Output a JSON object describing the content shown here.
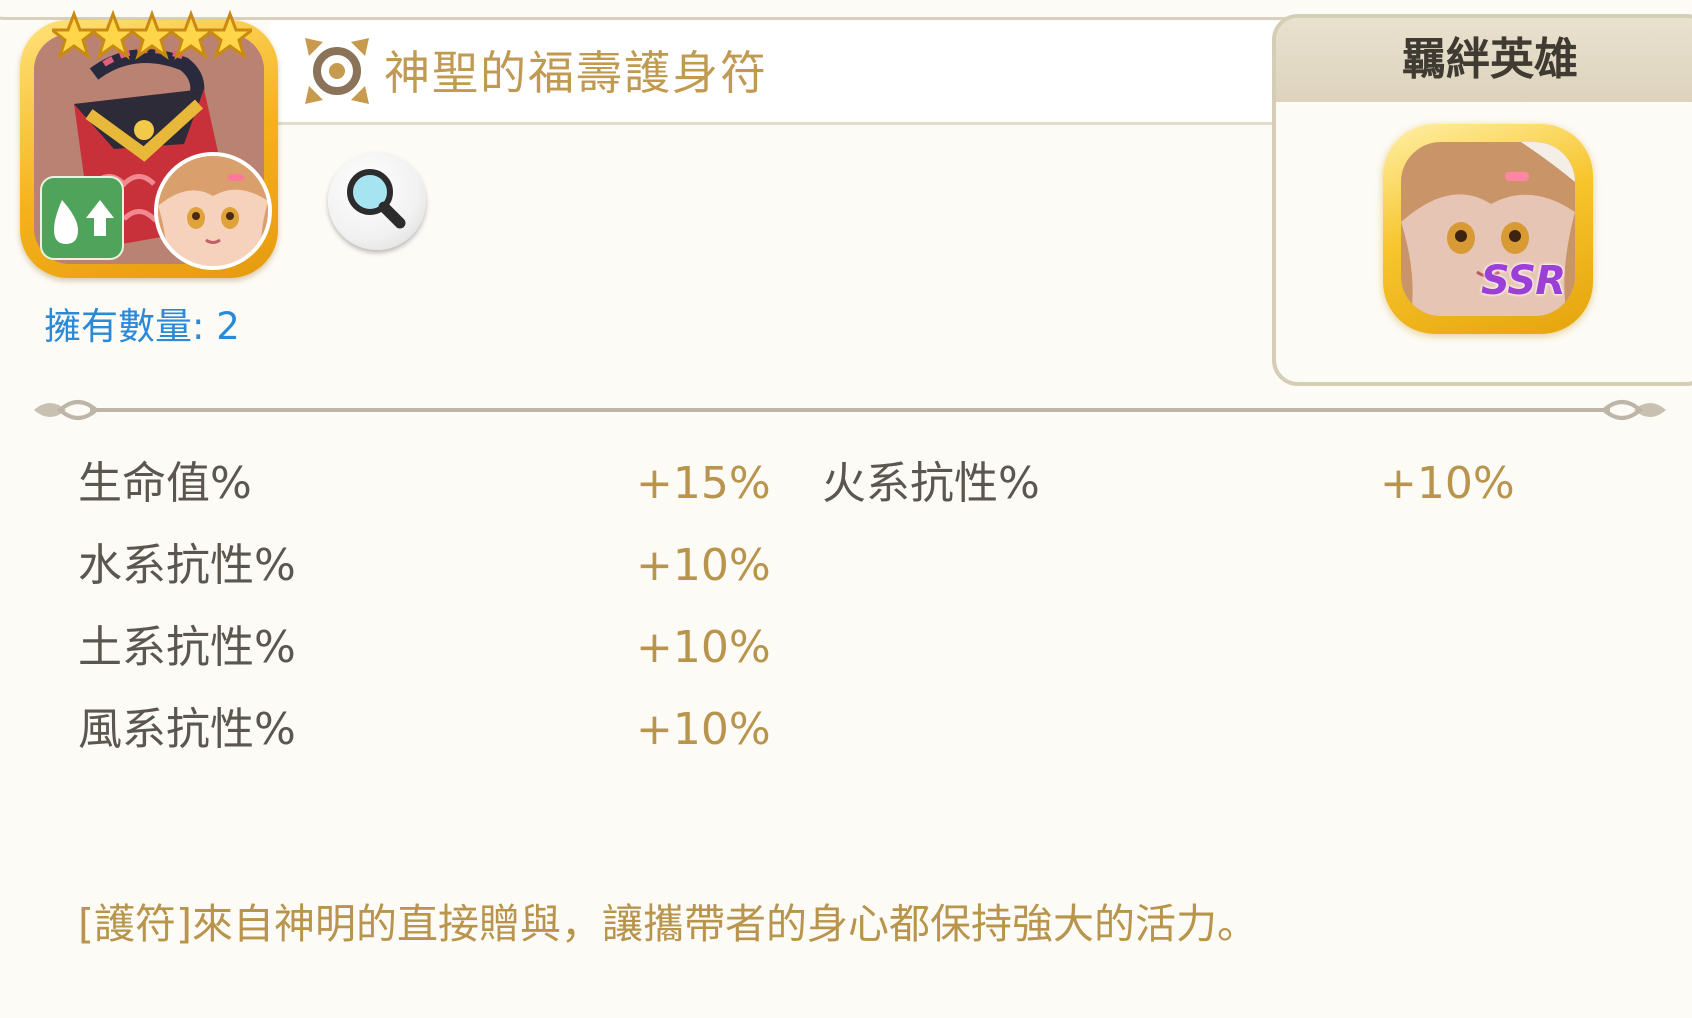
{
  "item": {
    "name": "神聖的福壽護身符",
    "star_count": 5,
    "owned_label": "擁有數量: 2",
    "element_icon": "water-up-icon",
    "category_icon": "amulet-slot-icon"
  },
  "bond": {
    "title": "羈絆英雄",
    "hero_rarity": "SSR"
  },
  "stats": [
    {
      "label": "生命值%",
      "value": "+15%"
    },
    {
      "label": "火系抗性%",
      "value": "+10%"
    },
    {
      "label": "水系抗性%",
      "value": "+10%"
    },
    {
      "label": "土系抗性%",
      "value": "+10%"
    },
    {
      "label": "風系抗性%",
      "value": "+10%"
    }
  ],
  "description": "[護符]來自神明的直接贈與，讓攜帶者的身心都保持強大的活力。",
  "colors": {
    "title_gold": "#c19a52",
    "value_gold": "#b8944c",
    "owned_blue": "#2a8ad8",
    "rarity_purple": "#9b3fd6",
    "background": "#fdfbf6"
  }
}
